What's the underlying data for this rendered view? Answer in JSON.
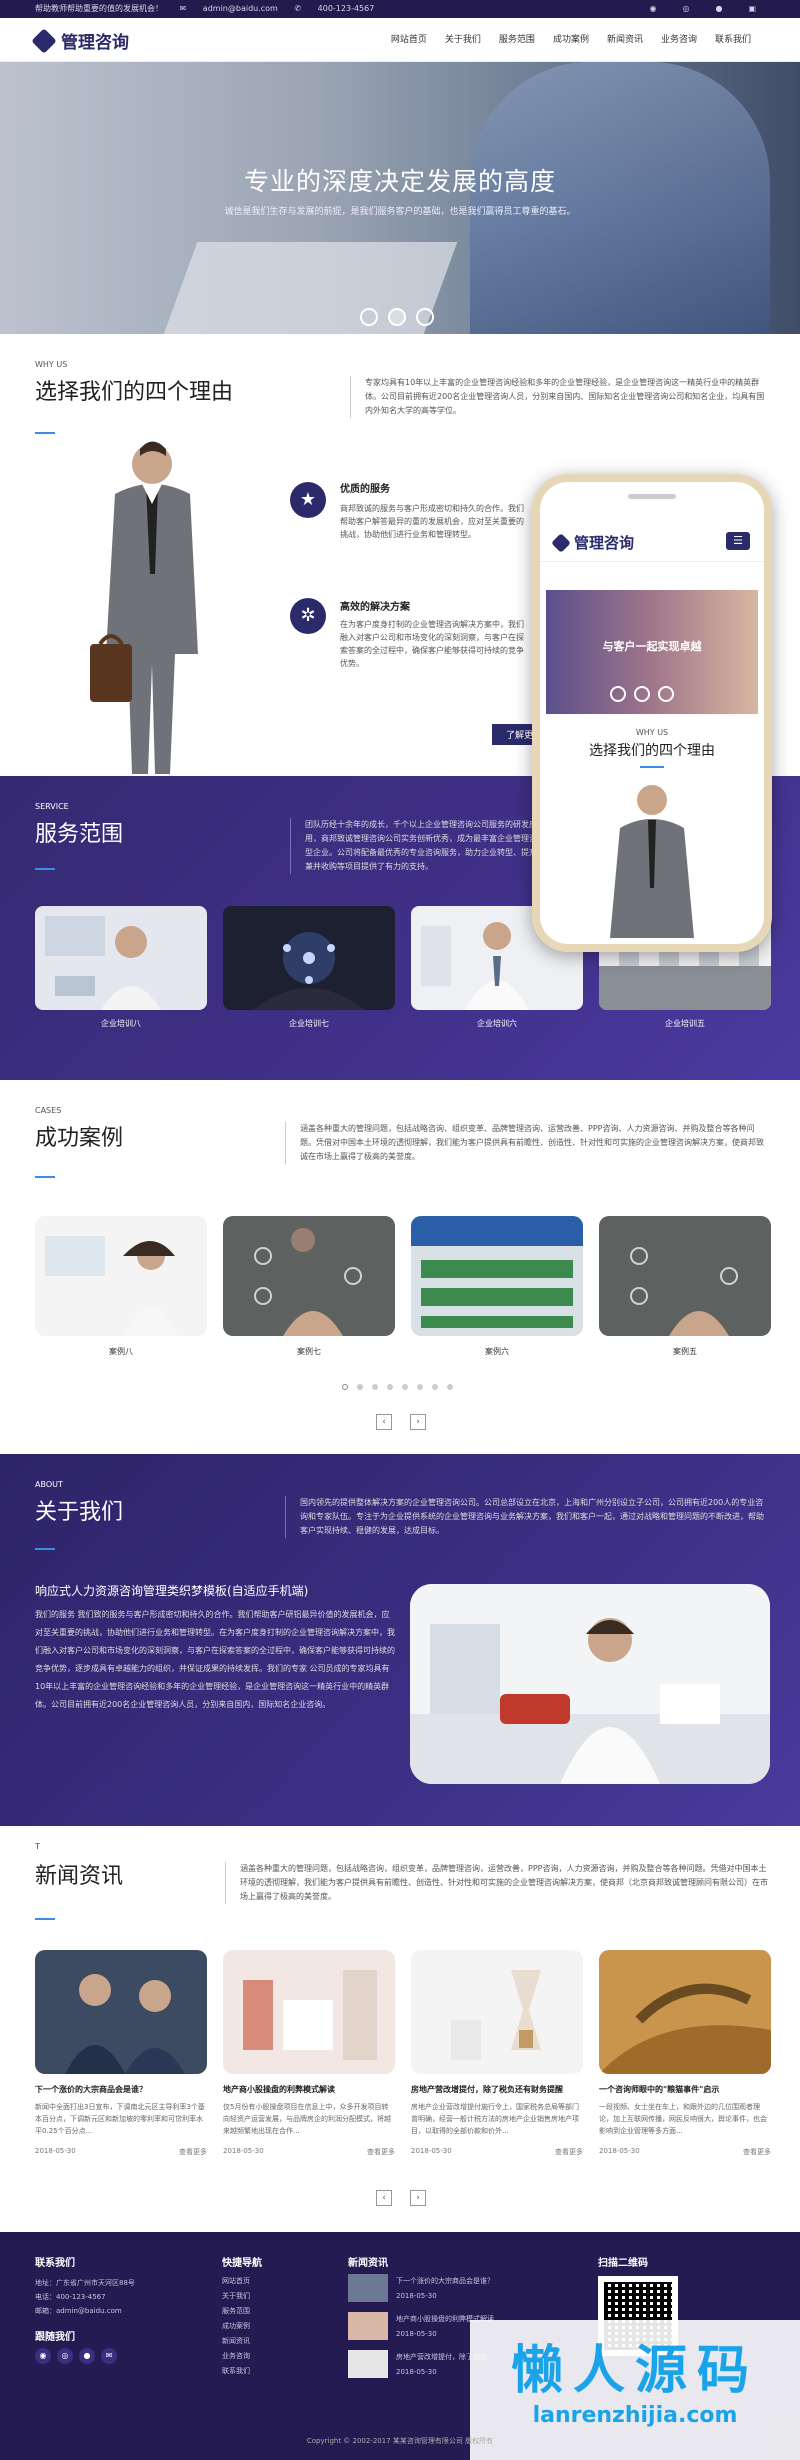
{
  "topbar": {
    "tagline": "帮助教师帮助重要的值的发展机会！",
    "email": "admin@baidu.com",
    "phone": "400-123-4567"
  },
  "header": {
    "logo": "管理咨询",
    "nav": [
      "网站首页",
      "关于我们",
      "服务范围",
      "成功案例",
      "新闻资讯",
      "业务咨询",
      "联系我们"
    ]
  },
  "hero": {
    "title": "专业的深度决定发展的高度",
    "subtitle": "诚信是我们生存与发展的前提，是我们服务客户的基础，也是我们赢得员工尊重的基石。"
  },
  "why": {
    "small": "WHY US",
    "title": "选择我们的四个理由",
    "desc": "专家均具有10年以上丰富的企业管理咨询经验和多年的企业管理经验，是企业管理咨询这一精英行业中的精英群体。公司目前拥有近200名企业管理咨询人员，分别来自国内、国际知名企业管理咨询公司和知名企业，均具有国内外知名大学的高等学位。",
    "features": [
      {
        "title": "优质的服务",
        "text": "商邦致诚的服务与客户形成密切和持久的合作。我们帮助客户解答最异的重的发展机会，应对至关重要的挑战，协助他们进行业务和管理转型。"
      },
      {
        "title": "高效的解决方案",
        "text": "在为客户度身打制的企业管理咨询解决方案中，我们融入对客户公司和市场变化的深刻洞察，与客户在探索答案的全过程中，确保客户能够获得可持续的竞争优势。"
      }
    ],
    "more": "了解更多"
  },
  "phone": {
    "logo": "管理咨询",
    "menu": "☰",
    "banner": "与客户一起实现卓越",
    "small": "WHY US",
    "title": "选择我们的四个理由"
  },
  "service": {
    "small": "SERVICE",
    "title": "服务范围",
    "desc": "团队历经十余年的成长，千个以上企业管理咨询公司服务的研发应用，商邦致诚管理咨询公司实务创新优秀，成为最丰富企业管理咨询型企业。公司将配备最优秀的专业咨询服务，助力企业转型、提升，兼并收购等项目提供了有力的支持。",
    "items": [
      "企业培训八",
      "企业培训七",
      "企业培训六",
      "企业培训五"
    ]
  },
  "cases": {
    "small": "CASES",
    "title": "成功案例",
    "desc": "涵盖各种重大的管理问题，包括战略咨询、组织变革、品牌管理咨询、运营改善、PPP咨询、人力资源咨询、并购及整合等各种问题。凭借对中国本土环境的透彻理解，我们能为客户提供具有前瞻性、创造性、针对性和可实施的企业管理咨询解决方案，使商邦致诚在市场上赢得了极高的美誉度。",
    "items": [
      "案例八",
      "案例七",
      "案例六",
      "案例五"
    ],
    "prev": "‹",
    "next": "›"
  },
  "about": {
    "small": "ABOUT",
    "title": "关于我们",
    "desc": "国内领先的提供整体解决方案的企业管理咨询公司。公司总部设立在北京，上海和广州分别设立子公司，公司拥有近200人的专业咨询和专家队伍。专注于为企业提供系统的企业管理咨询与业务解决方案，我们和客户一起，通过对战略和管理问题的不断改进，帮助客户实现持续、稳健的发展，达成目标。",
    "heading": "响应式人力资源咨询管理类织梦模板(自适应手机端)",
    "body": "我们的服务 我们致的服务与客户形成密切和持久的合作。我们帮助客户研铝最异价值的发展机会，应对至关重要的挑战，协助他们进行业务和管理转型。在为客户度身打制的企业管理咨询解决方案中，我们融入对客户公司和市场变化的深刻洞察，与客户在探索答案的全过程中，确保客户能够获得可持续的竞争优势，逐步成具有卓越能力的组织，并保证成果的持续发挥。我们的专家 公司员成的专家均具有10年以上丰富的企业管理咨询经验和多年的企业管理经验，是企业管理咨询这一精英行业中的精英群体。公司目前拥有近200名企业管理咨询人员，分别来自国内，国际知名企业咨询。"
  },
  "news": {
    "small": "T",
    "title": "新闻资讯",
    "desc": "涵盖各种重大的管理问题，包括战略咨询，组织变革，品牌管理咨询，运营改善，PPP咨询，人力资源咨询，并购及整合等各种问题。凭借对中国本土环境的透彻理解，我们能为客户提供具有前瞻性、创造性、针对性和可实施的企业管理咨询解决方案，使商邦（北京商邦致诚管理顾问有限公司）在市场上赢得了极高的美誉度。",
    "items": [
      {
        "title": "下一个涨价的大宗商品会是谁？",
        "text": "新闻中全面打出3日宣布，下调南北元区主导利率3个基本百分点，下调新元区和新加坡的零利率和可贷利率水平0.25个百分点...",
        "date": "2018-05-30",
        "more": "查看更多"
      },
      {
        "title": "地产商小股操盘的利弊模式解读",
        "text": "仅5月份有小股操盘项目在信息上中，众多开发项目转向轻资产运营发展，与品牌房企的利润分配模式，将越来越频繁地出现在合作...",
        "date": "2018-05-30",
        "more": "查看更多"
      },
      {
        "title": "房地产营改增提付，除了税负还有财务提醒",
        "text": "房地产企业营改增提付施行令上，国家税务总局等部门曾明确，经营一般计税方法的房地产企业销售房地产项目，以取得的全部价款和价外...",
        "date": "2018-05-30",
        "more": "查看更多"
      },
      {
        "title": "一个咨询师眼中的\"粮猫事件\"启示",
        "text": "一段视频、女士坐在车上，和跟外边的几位围观者理论，加上互联网传播，网民反响很大，舆论事件，也会影响到企业管理等多方面...",
        "date": "2018-05-30",
        "more": "查看更多"
      }
    ],
    "prev": "‹",
    "next": "›"
  },
  "footer": {
    "contact_title": "联系我们",
    "address": "地址：广东省广州市天河区88号",
    "phone": "电话：400-123-4567",
    "email": "邮箱：admin@baidu.com",
    "follow_title": "跟随我们",
    "quick_title": "快捷导航",
    "quick": [
      "网站首页",
      "关于我们",
      "服务范围",
      "成功案例",
      "新闻资讯",
      "业务咨询",
      "联系我们"
    ],
    "news_title": "新闻资讯",
    "news": [
      {
        "title": "下一个涨价的大宗商品会是谁？",
        "date": "2018-05-30"
      },
      {
        "title": "地产商小股操盘的利弊模式解读",
        "date": "2018-05-30"
      },
      {
        "title": "房地产营改增提付，除了税负...",
        "date": "2018-05-30"
      }
    ],
    "qr_title": "扫描二维码",
    "copyright": "Copyright © 2002-2017 某某咨询管理有限公司 版权所有"
  },
  "watermark": {
    "title": "懒人源码",
    "url": "lanrenzhijia.com"
  },
  "colors": {
    "brand": "#2b2a6b",
    "accent": "#3b8fe0",
    "purple": "#3f2f86"
  }
}
